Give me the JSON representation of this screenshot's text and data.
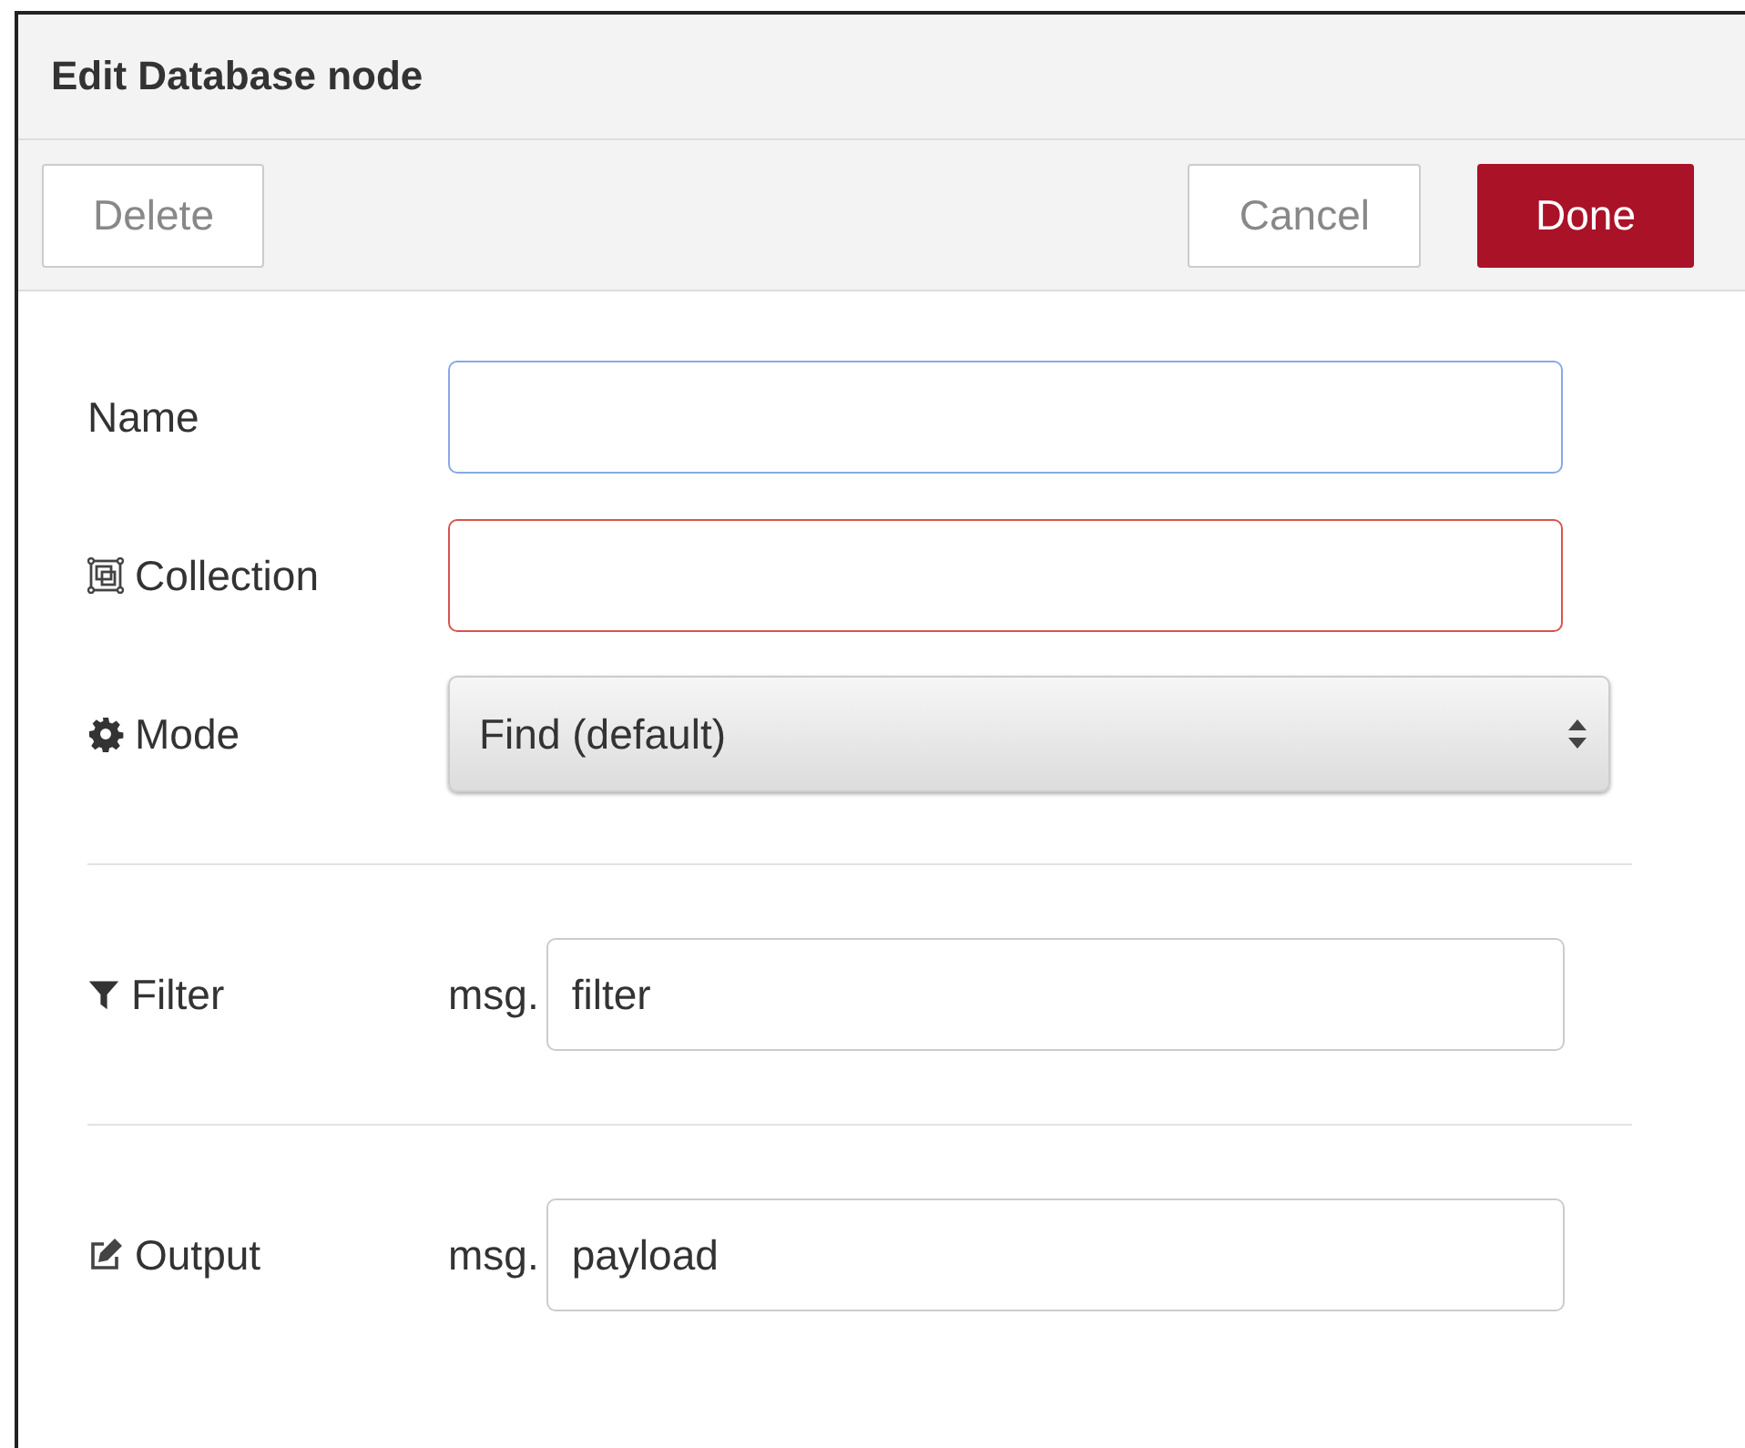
{
  "dialog": {
    "title": "Edit Database node"
  },
  "toolbar": {
    "left_buttons": [
      {
        "label": "Delete"
      }
    ],
    "right_buttons": [
      {
        "label": "Cancel",
        "kind": "plain"
      },
      {
        "label": "Done",
        "kind": "primary"
      }
    ]
  },
  "sections": [
    [
      {
        "label": "Name",
        "kind": "text",
        "focused": true,
        "invalid": false
      },
      {
        "label": "Collection",
        "kind": "text",
        "focused": false,
        "invalid": true
      },
      {
        "label": "Mode",
        "kind": "select",
        "value": "Find (default)"
      }
    ],
    [
      {
        "label": "Filter",
        "kind": "msg",
        "prefix": "msg.",
        "value": "filter"
      }
    ],
    [
      {
        "label": "Output",
        "kind": "msg",
        "prefix": "msg.",
        "value": "payload"
      }
    ]
  ]
}
